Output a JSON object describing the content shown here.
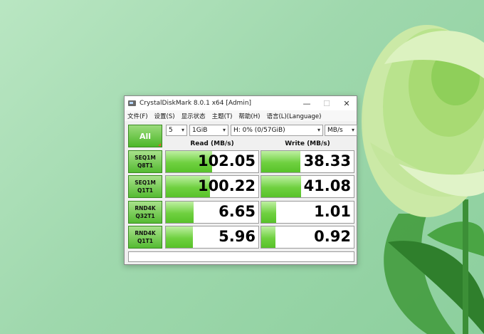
{
  "window": {
    "title": "CrystalDiskMark 8.0.1 x64 [Admin]",
    "minimize": "—",
    "maximize": "☐",
    "close": "✕"
  },
  "menu": [
    "文件(F)",
    "设置(S)",
    "显示状态",
    "主题(T)",
    "帮助(H)",
    "语言(L)(Language)"
  ],
  "toolbar": {
    "all_label": "All",
    "count": "5",
    "size": "1GiB",
    "drive": "H: 0% (0/57GiB)",
    "unit": "MB/s"
  },
  "headers": {
    "read": "Read (MB/s)",
    "write": "Write (MB/s)"
  },
  "tests": [
    {
      "line1": "SEQ1M",
      "line2": "Q8T1",
      "read": "102.05",
      "write": "38.33",
      "read_fill": 0.5,
      "write_fill": 0.42
    },
    {
      "line1": "SEQ1M",
      "line2": "Q1T1",
      "read": "100.22",
      "write": "41.08",
      "read_fill": 0.48,
      "write_fill": 0.43
    },
    {
      "line1": "RND4K",
      "line2": "Q32T1",
      "read": "6.65",
      "write": "1.01",
      "read_fill": 0.3,
      "write_fill": 0.16
    },
    {
      "line1": "RND4K",
      "line2": "Q1T1",
      "read": "5.96",
      "write": "0.92",
      "read_fill": 0.29,
      "write_fill": 0.15
    }
  ],
  "comment": ""
}
